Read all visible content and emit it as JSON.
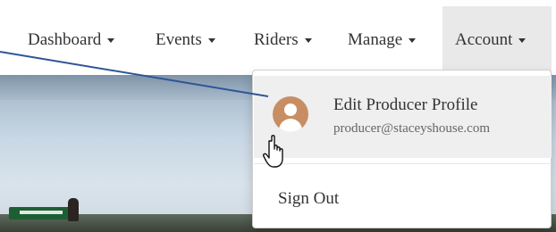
{
  "navbar": {
    "items": [
      {
        "label": "Dashboard"
      },
      {
        "label": "Events"
      },
      {
        "label": "Riders"
      },
      {
        "label": "Manage"
      },
      {
        "label": "Account"
      }
    ]
  },
  "dropdown": {
    "profile_title": "Edit Producer Profile",
    "profile_email": "producer@staceyshouse.com",
    "signout_label": "Sign Out"
  },
  "icons": {
    "avatar": "user-avatar-icon",
    "caret": "caret-down-icon",
    "cursor": "hand-pointer-icon"
  },
  "colors": {
    "avatar": "#c88e63",
    "annotation_line": "#2f5597",
    "active_menu_bg": "#e9e9e9",
    "hover_bg": "#efefef"
  }
}
